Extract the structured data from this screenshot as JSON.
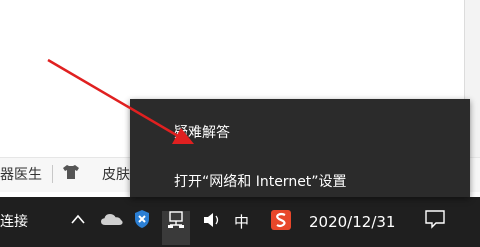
{
  "bottom_strip": {
    "item1": "器医生",
    "item2": "皮肤"
  },
  "taskbar": {
    "left_label": "连接",
    "ime_label": "中",
    "date": "2020/12/31"
  },
  "context_menu": {
    "items": [
      {
        "label": "疑难解答"
      },
      {
        "label": "打开“网络和 Internet”设置"
      }
    ]
  },
  "icons": {
    "shirt": "shirt-icon",
    "chevron": "chevron-up-icon",
    "cloud": "onedrive-cloud-icon",
    "defender": "defender-shield-icon",
    "network": "network-icon",
    "volume": "volume-icon",
    "sogou": "sogou-ime-icon",
    "notification": "notification-icon"
  },
  "colors": {
    "taskbar": "#1f1f1f",
    "menu": "#2b2b2b",
    "arrow": "#e02020",
    "sogou": "#e8472a"
  }
}
